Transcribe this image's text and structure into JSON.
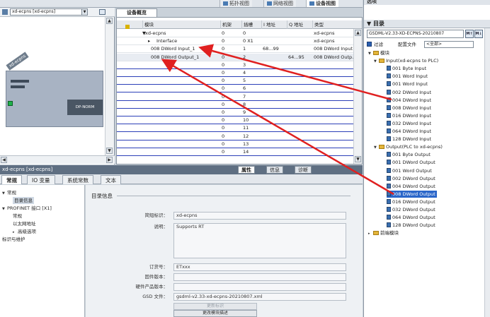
{
  "top_tabs": [
    {
      "label": "拓扑视图",
      "active": false
    },
    {
      "label": "网络视图",
      "active": false
    },
    {
      "label": "设备视图",
      "active": true
    }
  ],
  "left_pane": {
    "device_select": "xd-ecpns [xd-ecpns]",
    "device_label": "xd-ecpns",
    "module_label": "DP-NORM"
  },
  "device_overview": {
    "tab": "设备概览",
    "columns": [
      "模块",
      "机架",
      "插槽",
      "I 地址",
      "Q 地址",
      "类型"
    ],
    "rows": [
      {
        "module": "xd-ecpns",
        "rack": "0",
        "slot": "0",
        "i_addr": "",
        "q_addr": "",
        "type": "xd-ecpns",
        "level": 0
      },
      {
        "module": "Interface",
        "rack": "0",
        "slot": "0 X1",
        "i_addr": "",
        "q_addr": "",
        "type": "xd-ecpns",
        "level": 1
      },
      {
        "module": "008 DWord Input_1",
        "rack": "0",
        "slot": "1",
        "i_addr": "68...99",
        "q_addr": "",
        "type": "008 DWord Input",
        "level": 1
      },
      {
        "module": "008 DWord Output_1",
        "rack": "0",
        "slot": "2",
        "i_addr": "",
        "q_addr": "64...95",
        "type": "008 DWord Outp...",
        "level": 1
      },
      {
        "module": "",
        "rack": "0",
        "slot": "3"
      },
      {
        "module": "",
        "rack": "0",
        "slot": "4"
      },
      {
        "module": "",
        "rack": "0",
        "slot": "5"
      },
      {
        "module": "",
        "rack": "0",
        "slot": "6"
      },
      {
        "module": "",
        "rack": "0",
        "slot": "7"
      },
      {
        "module": "",
        "rack": "0",
        "slot": "8"
      },
      {
        "module": "",
        "rack": "0",
        "slot": "9"
      },
      {
        "module": "",
        "rack": "0",
        "slot": "10"
      },
      {
        "module": "",
        "rack": "0",
        "slot": "11"
      },
      {
        "module": "",
        "rack": "0",
        "slot": "12"
      },
      {
        "module": "",
        "rack": "0",
        "slot": "13"
      },
      {
        "module": "",
        "rack": "0",
        "slot": "14"
      }
    ]
  },
  "properties": {
    "title": "xd-ecpns [xd-ecpns]",
    "view_tabs": [
      "属性",
      "信息",
      "诊断"
    ],
    "sub_tabs": [
      "常规",
      "IO 变量",
      "系统常数",
      "文本"
    ],
    "nav": [
      {
        "label": "常规",
        "level": 0,
        "twisty": "▼"
      },
      {
        "label": "目录信息",
        "level": 1,
        "selected": true
      },
      {
        "label": "PROFINET 接口 [X1]",
        "level": 0,
        "twisty": "▼"
      },
      {
        "label": "常规",
        "level": 1
      },
      {
        "label": "以太网地址",
        "level": 1
      },
      {
        "label": "高级选项",
        "level": 1,
        "twisty": "▸"
      },
      {
        "label": "标识与维护",
        "level": 0
      }
    ],
    "section_title": "目录信息",
    "fields": {
      "short_id_label": "简短标识：",
      "short_id": "xd-ecpns",
      "desc_label": "说明：",
      "desc": "Supports RT",
      "order_label": "订货号：",
      "order": "ETxxx",
      "fw_label": "固件版本：",
      "fw": "",
      "hw_label": "硬件产品版本：",
      "hw": "",
      "gsd_label": "GSD 文件：",
      "gsd": "gsdml-v2.33-xd-ecpns-20210807.xml"
    },
    "update_btn": "更新标识",
    "change_btn": "更改模块描述"
  },
  "catalog": {
    "pane_title": "选项",
    "title": "目录",
    "search_value": "GSDML-V2.33-XD-ECPNS-20210807",
    "filter_label": "过滤",
    "config_label": "配置文件",
    "config_value": "<全部>",
    "root": "模块",
    "input_folder": "Input(xd-ecpns to PLC)",
    "inputs": [
      "001 Byte Input",
      "001 Word Input",
      "001 Word Input",
      "002 DWord Input",
      "004 DWord Input",
      "008 DWord Input",
      "016 DWord Input",
      "032 DWord Input",
      "064 DWord Input",
      "128 DWord Input"
    ],
    "output_folder": "Output(PLC to xd-ecpns)",
    "outputs": [
      "001 Byte Output",
      "001 DWord Output",
      "001 Word Output",
      "002 DWord Output",
      "004 DWord Output",
      "008 DWord Output",
      "016 DWord Output",
      "032 DWord Output",
      "064 DWord Output",
      "128 DWord Output"
    ],
    "selected_output_index": 5,
    "front_module": "前端模块"
  },
  "colors": {
    "arrow": "#e02020",
    "selection": "#2a66c9",
    "grid_line": "#2b3fb8"
  }
}
